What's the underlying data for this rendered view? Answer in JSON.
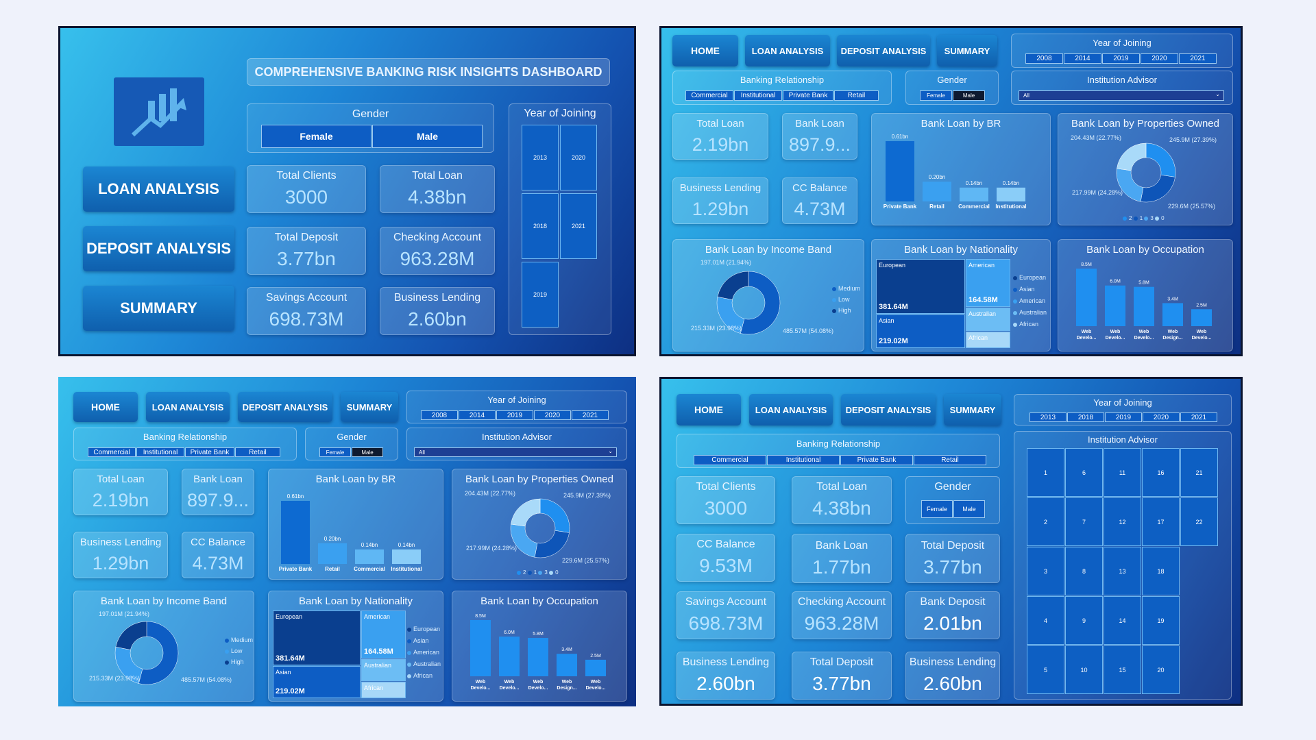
{
  "home": {
    "title": "COMPREHENSIVE BANKING RISK INSIGHTS DASHBOARD",
    "nav": [
      "LOAN ANALYSIS",
      "DEPOSIT ANALYSIS",
      "SUMMARY"
    ],
    "gender_title": "Gender",
    "gender": [
      "Female",
      "Male"
    ],
    "year_title": "Year of Joining",
    "years": [
      "2013",
      "2020",
      "2018",
      "2021",
      "2019"
    ],
    "kpis": [
      {
        "label": "Total Clients",
        "value": "3000"
      },
      {
        "label": "Total Loan",
        "value": "4.38bn"
      },
      {
        "label": "Total Deposit",
        "value": "3.77bn"
      },
      {
        "label": "Checking Account",
        "value": "963.28M"
      },
      {
        "label": "Savings Account",
        "value": "698.73M"
      },
      {
        "label": "Business Lending",
        "value": "2.60bn"
      }
    ],
    "colors": {
      "icon_bg": "#1659b5",
      "accent": "#0d5dc4"
    },
    "logo_icon": "bar-chart-trend-icon"
  },
  "loan": {
    "nav": [
      "HOME",
      "LOAN ANALYSIS",
      "DEPOSIT ANALYSIS",
      "SUMMARY"
    ],
    "year_title": "Year of Joining",
    "years": [
      "2008",
      "2014",
      "2019",
      "2020",
      "2021"
    ],
    "br_title": "Banking Relationship",
    "br": [
      "Commercial",
      "Institutional",
      "Private Bank",
      "Retail"
    ],
    "gender_title": "Gender",
    "gender": [
      "Female",
      "Male"
    ],
    "advisor_title": "Institution Advisor",
    "advisor_value": "All",
    "kpis": [
      {
        "label": "Total Loan",
        "value": "2.19bn"
      },
      {
        "label": "Bank Loan",
        "value": "897.9..."
      },
      {
        "label": "Business Lending",
        "value": "1.29bn"
      },
      {
        "label": "CC Balance",
        "value": "4.73M"
      }
    ],
    "br_chart": {
      "title": "Bank Loan by BR"
    },
    "prop_chart": {
      "title": "Bank Loan by Properties Owned"
    },
    "income_chart": {
      "title": "Bank Loan by Income Band"
    },
    "nat_chart": {
      "title": "Bank Loan by Nationality"
    },
    "occ_chart": {
      "title": "Bank Loan by Occupation"
    }
  },
  "summary": {
    "nav": [
      "HOME",
      "LOAN ANALYSIS",
      "DEPOSIT ANALYSIS",
      "SUMMARY"
    ],
    "year_title": "Year of Joining",
    "years": [
      "2013",
      "2018",
      "2019",
      "2020",
      "2021"
    ],
    "br_title": "Banking Relationship",
    "br": [
      "Commercial",
      "Institutional",
      "Private Bank",
      "Retail"
    ],
    "gender_title": "Gender",
    "gender": [
      "Female",
      "Male"
    ],
    "advisor_title": "Institution Advisor",
    "advisors": [
      "1",
      "6",
      "11",
      "16",
      "21",
      "2",
      "7",
      "12",
      "17",
      "22",
      "3",
      "8",
      "13",
      "18",
      "4",
      "9",
      "14",
      "19",
      "5",
      "10",
      "15",
      "20"
    ],
    "kpis": [
      {
        "label": "Total Clients",
        "value": "3000"
      },
      {
        "label": "Total Loan",
        "value": "4.38bn"
      },
      {
        "label": "CC Balance",
        "value": "9.53M"
      },
      {
        "label": "Bank Loan",
        "value": "1.77bn"
      },
      {
        "label": "Total Deposit",
        "value": "3.77bn"
      },
      {
        "label": "Savings Account",
        "value": "698.73M"
      },
      {
        "label": "Checking Account",
        "value": "963.28M"
      },
      {
        "label": "Bank Deposit",
        "value": "2.01bn"
      },
      {
        "label": "Business Lending",
        "value": "2.60bn"
      },
      {
        "label": "Total Deposit",
        "value": "3.77bn"
      },
      {
        "label": "Business Lending",
        "value": "2.60bn"
      }
    ]
  },
  "chart_data": [
    {
      "type": "bar",
      "title": "Bank Loan by BR",
      "categories": [
        "Private Bank",
        "Retail",
        "Commercial",
        "Institutional"
      ],
      "values": [
        0.61,
        0.2,
        0.14,
        0.14
      ],
      "data_labels": [
        "0.61bn",
        "0.20bn",
        "0.14bn",
        "0.14bn"
      ],
      "colors": [
        "#0d6ad1",
        "#3aa0f0",
        "#5fb7f4",
        "#8acdf8"
      ]
    },
    {
      "type": "pie",
      "title": "Bank Loan by Properties Owned",
      "categories": [
        "2",
        "1",
        "3",
        "0"
      ],
      "values": [
        245.9,
        229.6,
        217.99,
        204.43
      ],
      "data_labels": [
        "245.9M (27.39%)",
        "229.6M (25.57%)",
        "217.99M (24.28%)",
        "204.43M (22.77%)"
      ],
      "colors": [
        "#1f8ff0",
        "#0e55b8",
        "#4aa7f2",
        "#a9daf9"
      ]
    },
    {
      "type": "pie",
      "title": "Bank Loan by Income Band",
      "categories": [
        "Medium",
        "Low",
        "High"
      ],
      "values": [
        485.57,
        215.33,
        197.01
      ],
      "data_labels": [
        "485.57M (54.08%)",
        "215.33M (23.98%)",
        "197.01M (21.94%)"
      ],
      "colors": [
        "#0d5dc4",
        "#3aa0f0",
        "#0a3f8f"
      ]
    },
    {
      "type": "heatmap",
      "title": "Bank Loan by Nationality",
      "categories": [
        "European",
        "American",
        "Asian",
        "Australian",
        "African"
      ],
      "values": [
        381.64,
        164.58,
        219.02,
        null,
        null
      ],
      "data_labels": [
        "381.64M",
        "164.58M",
        "219.02M",
        "",
        ""
      ],
      "colors": [
        "#0a3f8f",
        "#3aa0f0",
        "#0d5dc4",
        "#6cbdf4",
        "#a8d8f8"
      ]
    },
    {
      "type": "bar",
      "title": "Bank Loan by Occupation",
      "categories": [
        "Web Develo...",
        "Web Develo...",
        "Web Develo...",
        "Web Design...",
        "Web Develo..."
      ],
      "values": [
        8.5,
        6.0,
        5.8,
        3.4,
        2.5
      ],
      "data_labels": [
        "8.5M",
        "6.0M",
        "5.8M",
        "3.4M",
        "2.5M"
      ],
      "colors": [
        "#1f8ff0"
      ]
    }
  ]
}
